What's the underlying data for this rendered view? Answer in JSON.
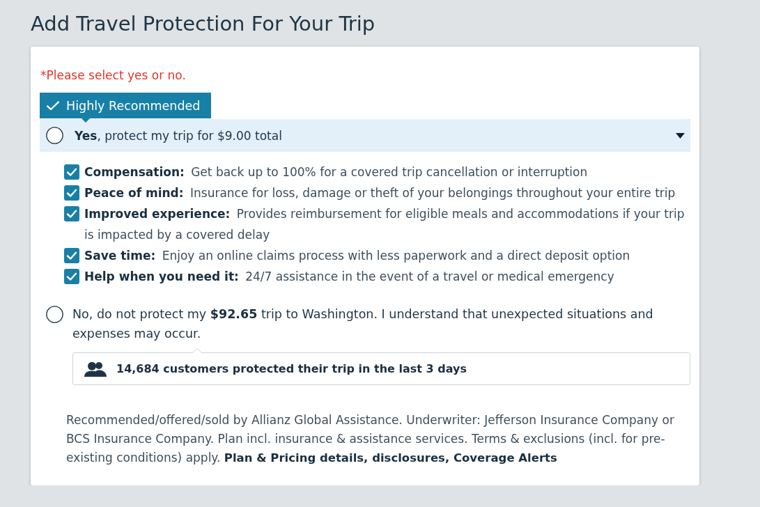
{
  "heading": "Add Travel Protection For Your Trip",
  "validation_message": "*Please select yes or no.",
  "options": [
    {
      "kind": "recommended",
      "badge": "Highly Recommended",
      "label": "**Yes**, protect my trip for $9.00 total",
      "selected": false,
      "expanded": true,
      "benefits": [
        {
          "text": "**Compensation:** Get back up to 100% for a covered trip cancellation or interruption",
          "checked": true
        },
        {
          "text": "**Peace of mind:** Insurance for loss, damage or theft of your belongings throughout your entire trip",
          "checked": true
        },
        {
          "text": "**Improved experience:** Provides reimbursement for eligible meals and accommodations if your trip is impacted by a covered delay",
          "checked": true
        },
        {
          "text": "**Save time:** Enjoy an online claims process with less paperwork and a direct deposit option",
          "checked": true
        },
        {
          "text": "**Help when you need it:** 24/7 assistance in the event of a travel or medical emergency",
          "checked": true
        }
      ]
    },
    {
      "kind": "decline",
      "label": "No, do not protect my **$92.65** trip to Washington. I understand that unexpected situations and expenses may occur.",
      "selected": false
    }
  ],
  "social_proof": "14,684 customers protected their trip in the last 3 days",
  "disclaimer": {
    "text": "Recommended/offered/sold by Allianz Global Assistance. Underwriter: Jefferson Insurance Company or BCS Insurance Company. Plan incl. insurance & assistance services. Terms & exclusions (incl. for pre-existing conditions) apply.",
    "link": "Plan & Pricing details, disclosures, Coverage Alerts"
  }
}
